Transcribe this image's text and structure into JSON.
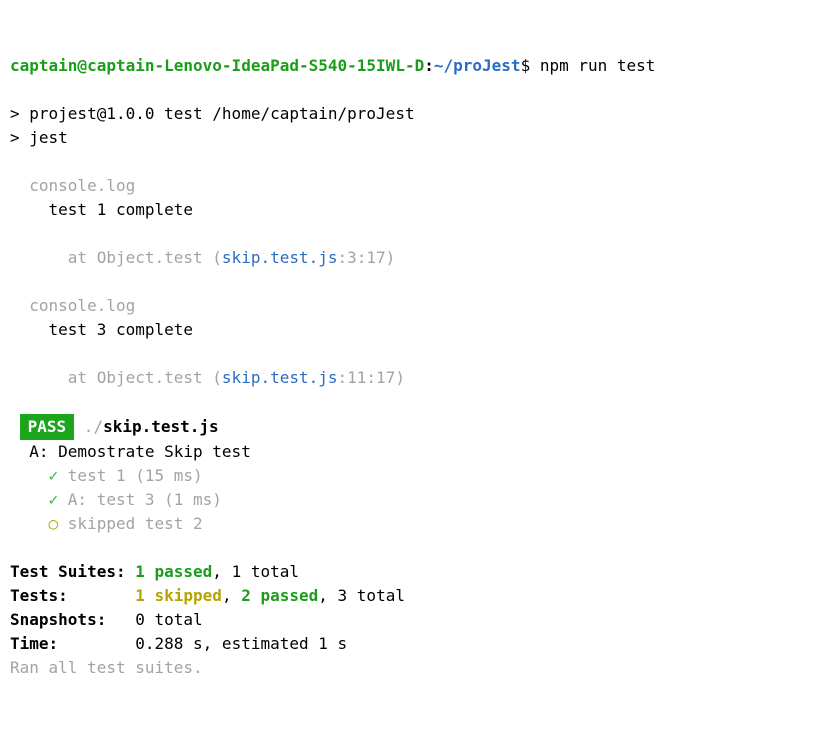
{
  "prompt": {
    "user": "captain@captain-Lenovo-IdeaPad-S540-15IWL-D",
    "sep1": ":",
    "path": "~/proJest",
    "sep2": "$ ",
    "command": "npm run test"
  },
  "npm": {
    "line1": "> projest@1.0.0 test /home/captain/proJest",
    "line2": "> jest"
  },
  "log1": {
    "header": "  console.log",
    "msg": "    test 1 complete",
    "atPrefix": "      at Object.test (",
    "file": "skip.test.js",
    "loc": ":3:17)"
  },
  "log2": {
    "header": "  console.log",
    "msg": "    test 3 complete",
    "atPrefix": "      at Object.test (",
    "file": "skip.test.js",
    "loc": ":11:17)"
  },
  "result": {
    "badge": "PASS",
    "pathPrefix": " ./",
    "file": "skip.test.js",
    "describe": "  A: Demostrate Skip test",
    "t1check": "    ✓ ",
    "t1text": "test 1 (15 ms)",
    "t2check": "    ✓ ",
    "t2text": "A: test 3 (1 ms)",
    "t3skip": "    ○ ",
    "t3text": "skipped test 2"
  },
  "summary": {
    "suitesLabel": "Test Suites: ",
    "suitesPassed": "1 passed",
    "suitesRest": ", 1 total",
    "testsLabel": "Tests:       ",
    "testsSkipped": "1 skipped",
    "testsSep": ", ",
    "testsPassed": "2 passed",
    "testsRest": ", 3 total",
    "snapshotsLabel": "Snapshots:   ",
    "snapshotsVal": "0 total",
    "timeLabel": "Time:        ",
    "timeVal": "0.288 s, estimated 1 s",
    "ran": "Ran all test suites."
  }
}
